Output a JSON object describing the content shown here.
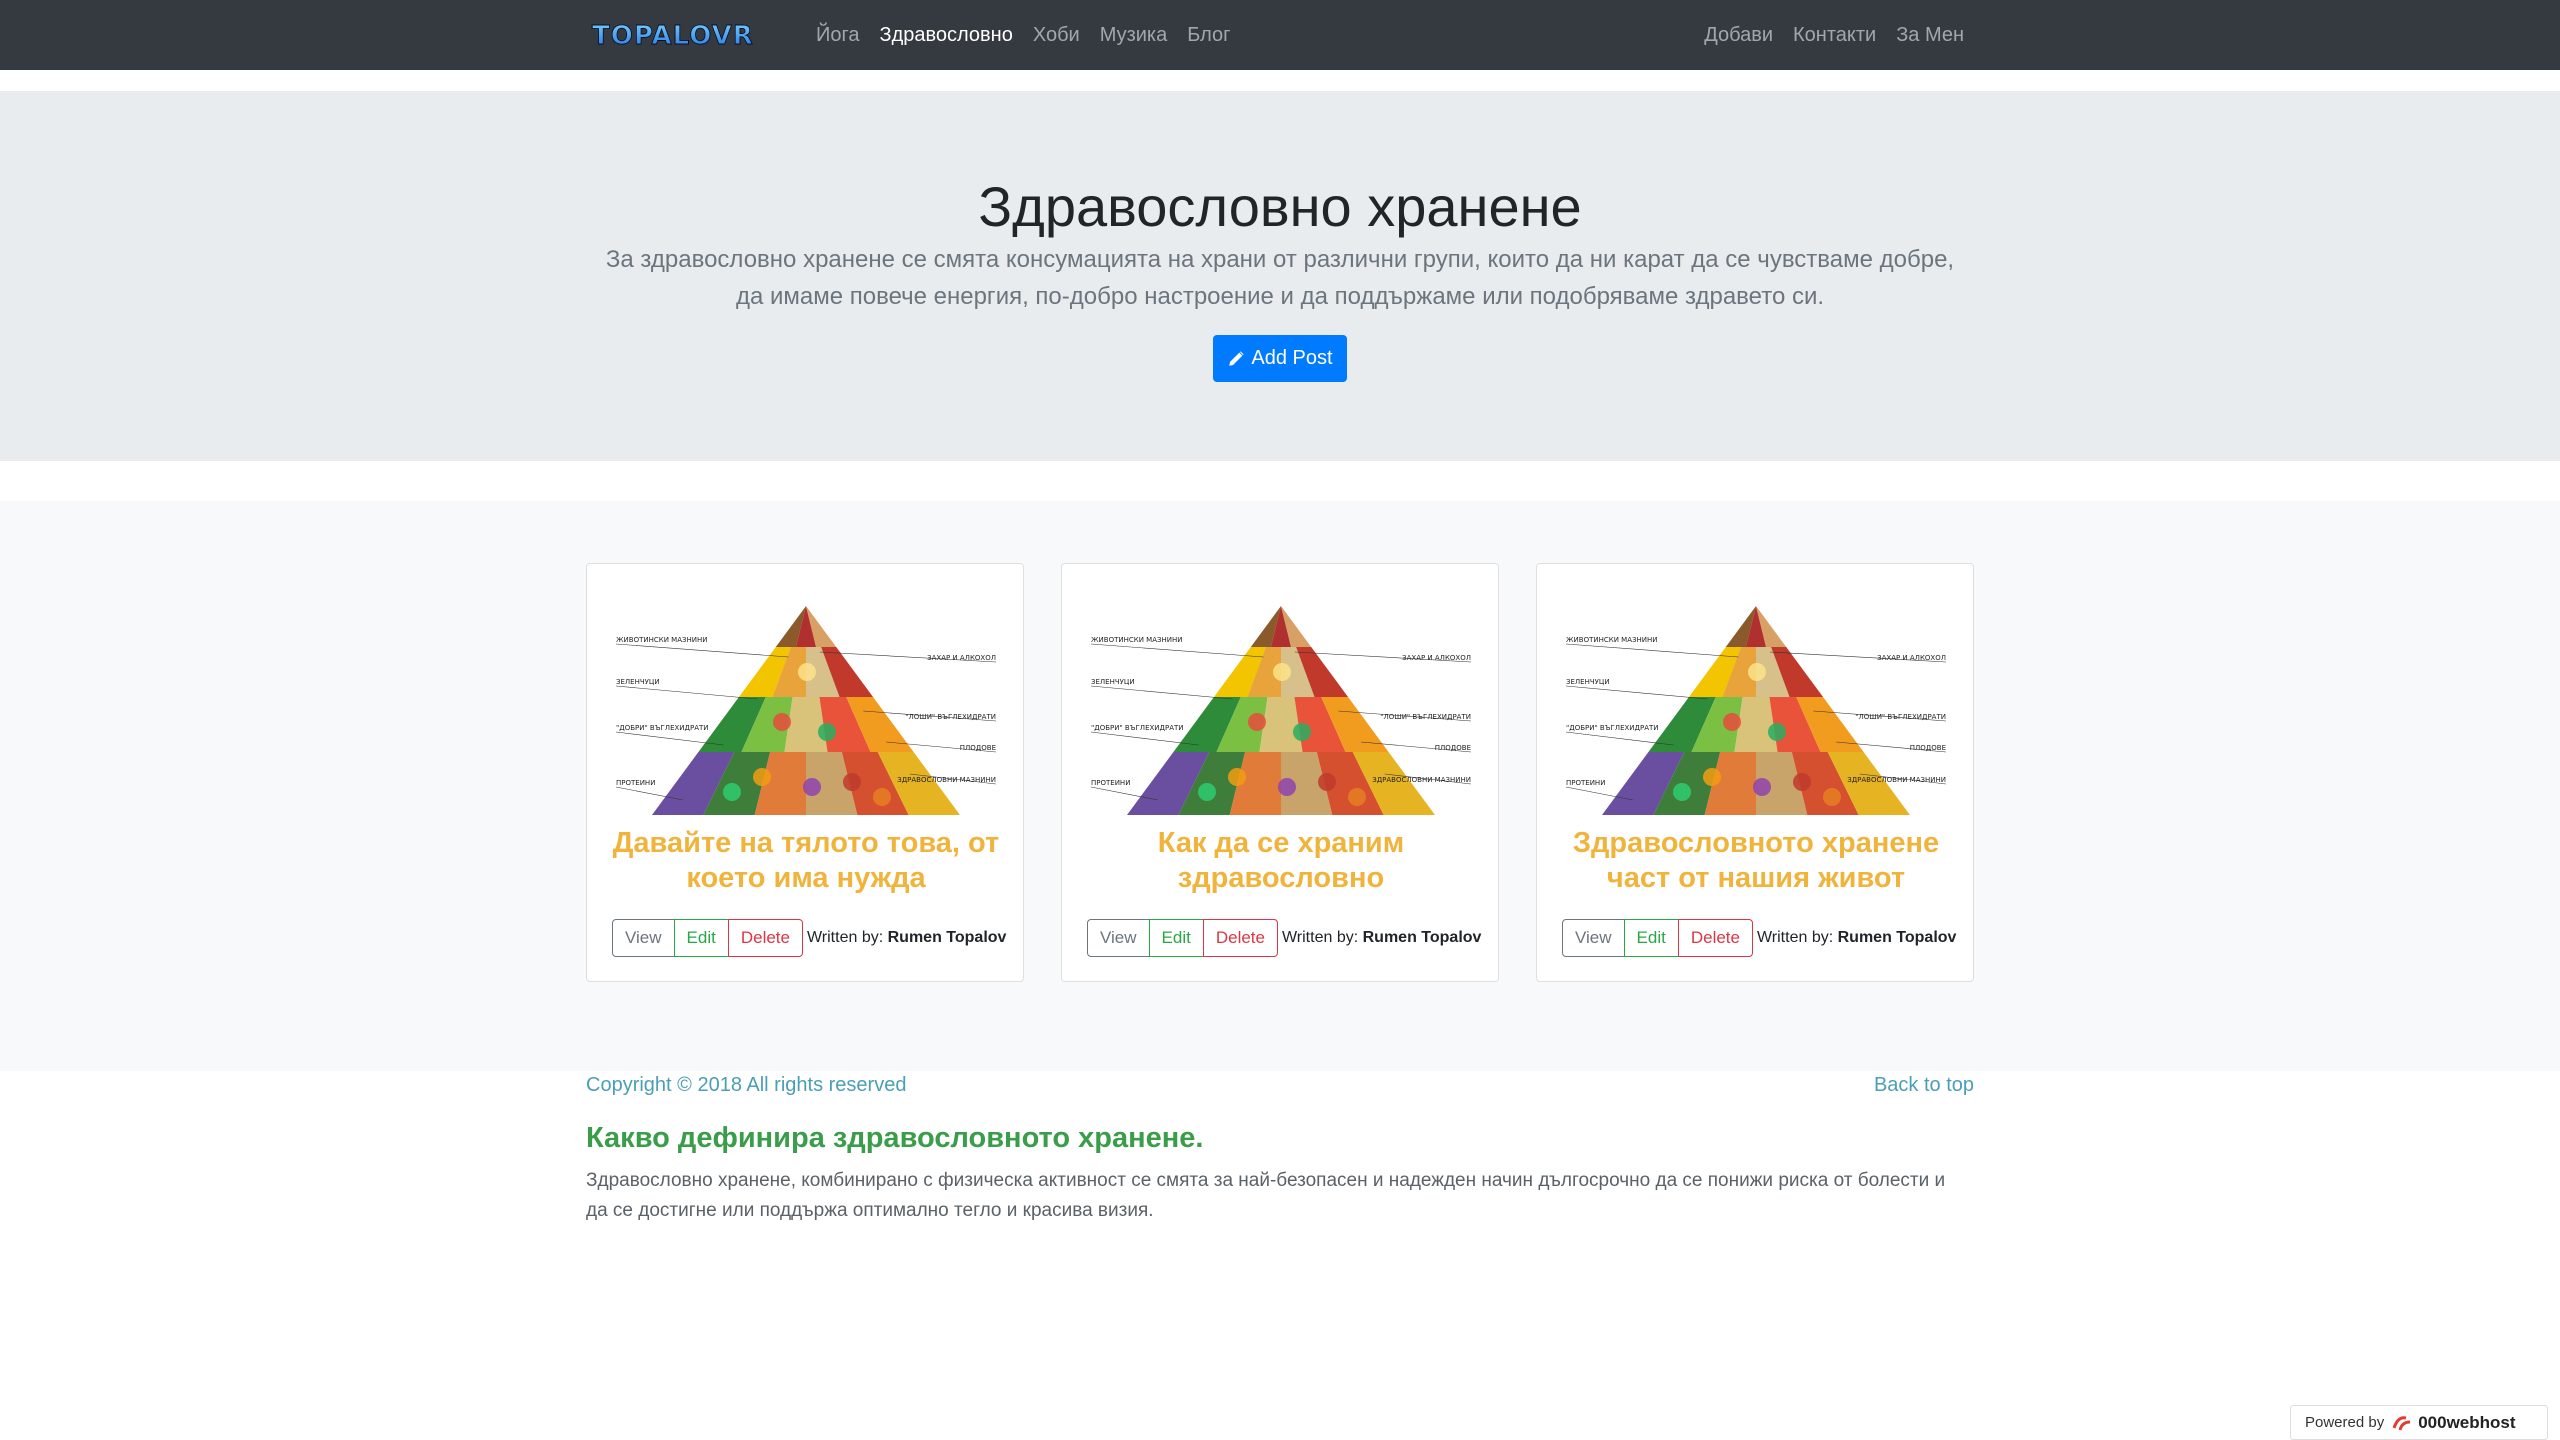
{
  "navbar": {
    "brand": "TOPALOVR",
    "left_links": [
      "Йога",
      "Здравословно",
      "Хоби",
      "Музика",
      "Блог"
    ],
    "right_links": [
      "Добави",
      "Контакти",
      "За Мен"
    ],
    "active": "Здравословно"
  },
  "jumbotron": {
    "title": "Здравословно хранене",
    "lead": "За здравословно хранене се смята консумацията на храни от различни групи, които да ни карат да се чувстваме добре, да имаме повече енергия, по-добро настроение и да поддържаме или подобряваме здравето си.",
    "add_post_label": "Add Post"
  },
  "cards": [
    {
      "title": "Давайте на тялото това, от което има нужда",
      "view_label": "View",
      "edit_label": "Edit",
      "delete_label": "Delete",
      "written_prefix": "Written by:",
      "author": "Rumen Topalov"
    },
    {
      "title": "Как да се храним здравословно",
      "view_label": "View",
      "edit_label": "Edit",
      "delete_label": "Delete",
      "written_prefix": "Written by:",
      "author": "Rumen Topalov"
    },
    {
      "title": "Здравословното хранене част от нашия живот",
      "view_label": "View",
      "edit_label": "Edit",
      "delete_label": "Delete",
      "written_prefix": "Written by:",
      "author": "Rumen Topalov"
    }
  ],
  "pyramid_labels": {
    "left": [
      "ЖИВОТИНСКИ МАЗНИНИ",
      "ЗЕЛЕНЧУЦИ",
      "\"ДОБРИ\" ВЪГЛЕХИДРАТИ",
      "ПРОТЕИНИ"
    ],
    "right": [
      "ЗАХАР И АЛКОХОЛ",
      "\"ЛОШИ\" ВЪГЛЕХИДРАТИ",
      "ПЛОДОВЕ",
      "ЗДРАВОСЛОВНИ МАЗНИНИ"
    ]
  },
  "footer": {
    "copyright": "Copyright © 2018 All rights reserved",
    "back_to_top": "Back to top",
    "heading": "Какво дефинира здравословното хранене.",
    "text": "Здравословно хранене, комбинирано с физическа активност се смята за най-безопасен и надежден начин дългосрочно да се понижи риска от болести и да се достигне или поддържа оптимално тегло и красива визия."
  },
  "badge": {
    "powered_by": "Powered by",
    "host": "000webhost"
  }
}
